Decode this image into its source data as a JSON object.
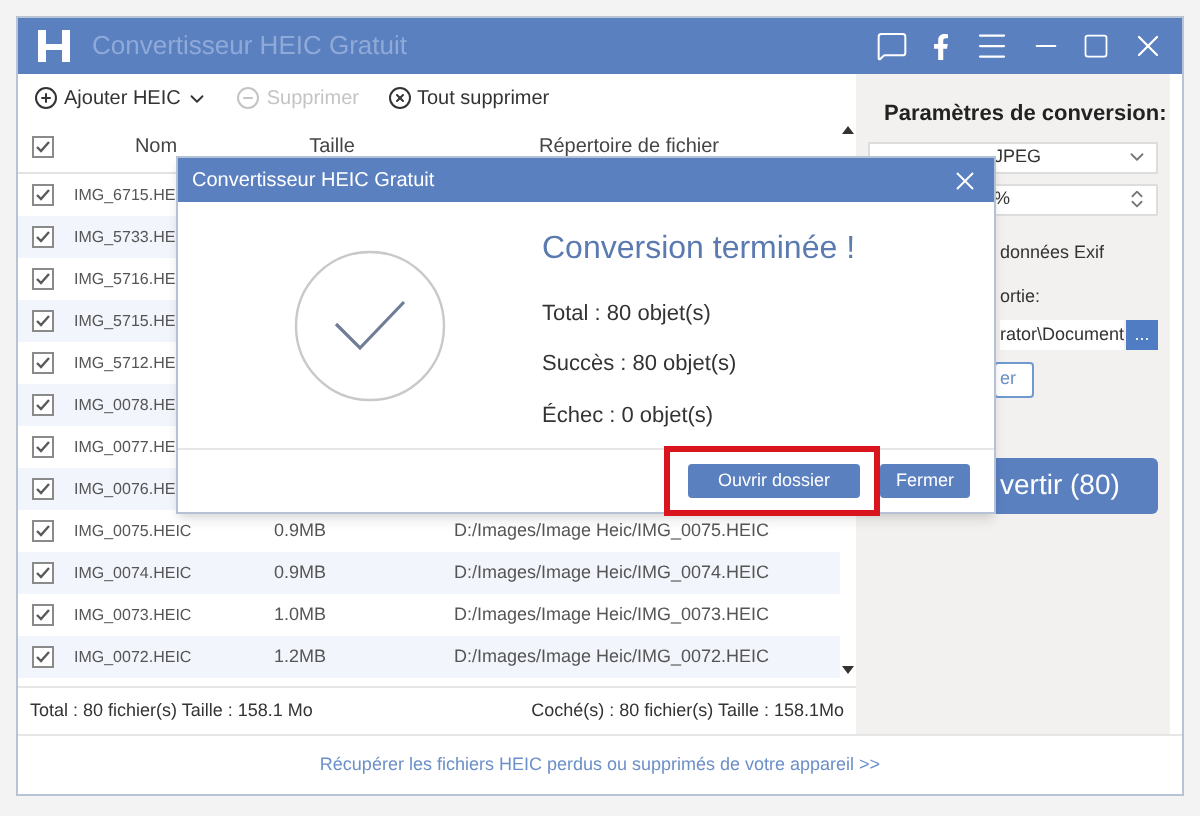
{
  "window": {
    "title": "Convertisseur HEIC Gratuit"
  },
  "toolbar": [
    {
      "kind": "add",
      "label": "Ajouter HEIC",
      "disabled": false
    },
    {
      "kind": "remove",
      "label": "Supprimer",
      "disabled": true
    },
    {
      "kind": "clear",
      "label": "Tout supprimer",
      "disabled": false
    }
  ],
  "table": {
    "all_checked": true,
    "columns": [
      "Nom",
      "Taille",
      "Répertoire de fichier"
    ],
    "rows": [
      {
        "checked": true,
        "name": "IMG_6715.HE"
      },
      {
        "checked": true,
        "name": "IMG_5733.HE"
      },
      {
        "checked": true,
        "name": "IMG_5716.HE"
      },
      {
        "checked": true,
        "name": "IMG_5715.HE"
      },
      {
        "checked": true,
        "name": "IMG_5712.HE"
      },
      {
        "checked": true,
        "name": "IMG_0078.HE"
      },
      {
        "checked": true,
        "name": "IMG_0077.HE"
      },
      {
        "checked": true,
        "name": "IMG_0076.HE"
      },
      {
        "checked": true,
        "name": "IMG_0075.HEIC",
        "size": "0.9MB",
        "path": "D:/Images/Image Heic/IMG_0075.HEIC"
      },
      {
        "checked": true,
        "name": "IMG_0074.HEIC",
        "size": "0.9MB",
        "path": "D:/Images/Image Heic/IMG_0074.HEIC"
      },
      {
        "checked": true,
        "name": "IMG_0073.HEIC",
        "size": "1.0MB",
        "path": "D:/Images/Image Heic/IMG_0073.HEIC"
      },
      {
        "checked": true,
        "name": "IMG_0072.HEIC",
        "size": "1.2MB",
        "path": "D:/Images/Image Heic/IMG_0072.HEIC"
      }
    ]
  },
  "footer": {
    "total": "Total : 80 fichier(s) Taille : 158.1 Mo",
    "checked": "Coché(s) : 80 fichier(s) Taille : 158.1Mo"
  },
  "link": "Récupérer les fichiers HEIC perdus ou supprimés de votre appareil >>",
  "settings": {
    "title": "Paramètres de conversion:",
    "format": "JPEG",
    "quality": "%",
    "exif": "données Exif",
    "output_label": "ortie:",
    "output_path": "rator\\Document",
    "browse": "...",
    "open_button": "er",
    "convert_button": "vertir (80)"
  },
  "dialog": {
    "title": "Convertisseur HEIC Gratuit",
    "heading": "Conversion terminée !",
    "lines": [
      "Total : 80 objet(s)",
      "Succès : 80 objet(s)",
      "Échec : 0 objet(s)"
    ],
    "buttons": [
      {
        "label": "Ouvrir dossier",
        "highlighted": true
      },
      {
        "label": "Fermer",
        "highlighted": false
      }
    ]
  }
}
